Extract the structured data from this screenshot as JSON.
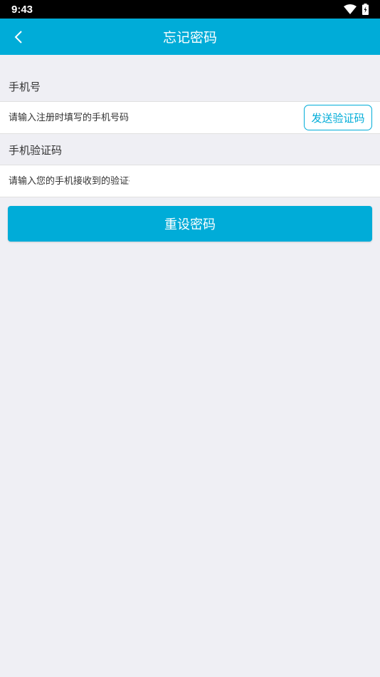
{
  "status_bar": {
    "time": "9:43"
  },
  "header": {
    "title": "忘记密码"
  },
  "phone_section": {
    "label": "手机号",
    "placeholder": "请输入注册时填写的手机号码",
    "send_code_label": "发送验证码"
  },
  "code_section": {
    "label": "手机验证码",
    "placeholder": "请输入您的手机接收到的验证码"
  },
  "submit_label": "重设密码",
  "colors": {
    "accent": "#00acd8",
    "background": "#efeff4"
  },
  "icons": {
    "back": "back-arrow-icon",
    "wifi": "wifi-icon",
    "battery": "battery-icon"
  }
}
